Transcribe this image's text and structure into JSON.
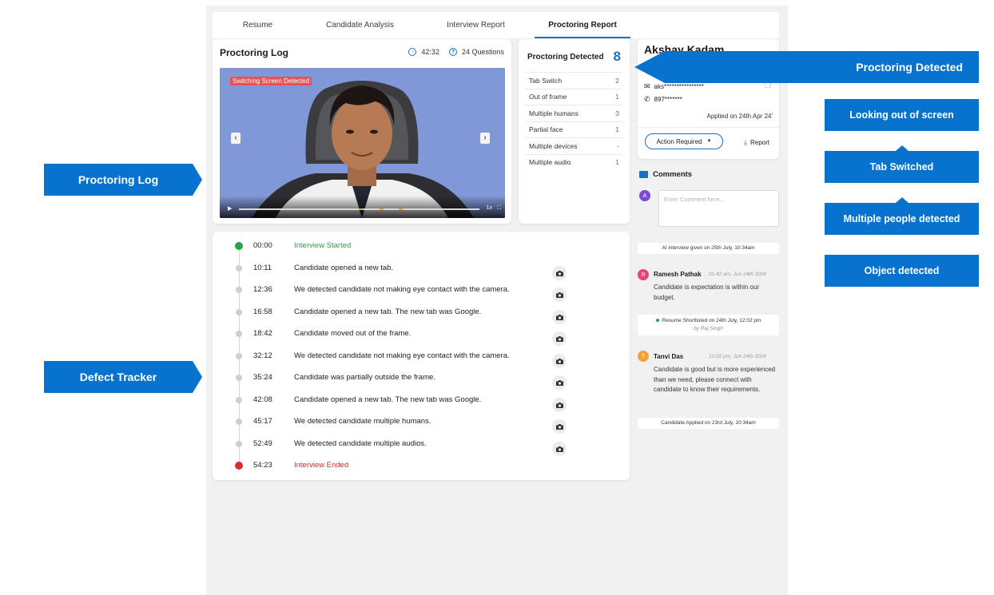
{
  "tabs": [
    {
      "label": "Resume",
      "active": false
    },
    {
      "label": "Candidate Analysis",
      "active": false
    },
    {
      "label": "Interview Report",
      "active": false
    },
    {
      "label": "Proctoring Report",
      "active": true
    }
  ],
  "proctoring_log": {
    "title": "Proctoring Log",
    "duration": "42:32",
    "questions": "24 Questions",
    "video": {
      "banner": "Switching Screen Detected",
      "speed": "1x",
      "prev_icon": "chevron-left-icon",
      "next_icon": "chevron-right-icon"
    }
  },
  "proctoring_detected": {
    "title": "Proctoring Detected",
    "count": "8",
    "items": [
      {
        "label": "Tab Switch",
        "value": "2"
      },
      {
        "label": "Out of frame",
        "value": "1"
      },
      {
        "label": "Multiple humans",
        "value": "3"
      },
      {
        "label": "Partial face",
        "value": "1"
      },
      {
        "label": "Multiple devices",
        "value": "-"
      },
      {
        "label": "Multiple audio",
        "value": "1"
      }
    ]
  },
  "defect_tracker": {
    "events": [
      {
        "time": "00:00",
        "text": "Interview Started",
        "kind": "start"
      },
      {
        "time": "10:11",
        "text": "Candidate opened a new tab.",
        "kind": "event"
      },
      {
        "time": "12:36",
        "text": "We detected candidate not making eye contact with the camera.",
        "kind": "event"
      },
      {
        "time": "16:58",
        "text": "Candidate opened a new tab. The new tab was Google.",
        "kind": "event"
      },
      {
        "time": "18:42",
        "text": "Candidate moved out of the frame.",
        "kind": "event"
      },
      {
        "time": "32:12",
        "text": "We detected candidate not making eye contact with the camera.",
        "kind": "event"
      },
      {
        "time": "35:24",
        "text": "Candidate was partially outside the frame.",
        "kind": "event"
      },
      {
        "time": "42:08",
        "text": "Candidate opened a new tab. The new tab was Google.",
        "kind": "event"
      },
      {
        "time": "45:17",
        "text": "We detected candidate multiple humans.",
        "kind": "event"
      },
      {
        "time": "52:49",
        "text": "We detected candidate multiple audios.",
        "kind": "event"
      },
      {
        "time": "54:23",
        "text": "Interview Ended",
        "kind": "end"
      }
    ]
  },
  "candidate": {
    "name": "Akshay Kadam",
    "email": "aks****************",
    "phone": "897*******",
    "applied": "Applied on 24th Apr 24'",
    "action_label": "Action Required",
    "report_label": "Report"
  },
  "comments": {
    "title": "Comments",
    "user_initial": "A",
    "placeholder": "Enter Comment here...",
    "activity_1": "AI interview given on 25th July, 10:34am",
    "comment_1": {
      "initial": "R",
      "name": "Ramesh Pathak",
      "time": "01:42 am, Jun 24th 2024",
      "text": "Candidate is expectation is within our budget."
    },
    "activity_2": "Resume Shortlisted on 24th July, 12:02 pm",
    "activity_2_by": "by Raj Singh",
    "comment_2": {
      "initial": "T",
      "name": "Tanvi Das",
      "time": "12:02 pm, Jun 24th 2024",
      "text": "Candidate is good but is more experienced than we need, please connect with candidate to know their requirements."
    },
    "activity_3": "Candidate Applied on 23rd July, 10:34am"
  },
  "callouts": {
    "proctoring_log": "Proctoring Log",
    "defect_tracker": "Defect Tracker",
    "proctoring_detected": "Proctoring Detected",
    "looking_out": "Looking out of screen",
    "tab_switched": "Tab Switched",
    "multiple_people": "Multiple people detected",
    "object_detected": "Object detected"
  },
  "colors": {
    "accent": "#0873cf",
    "brand": "#1f6fc1",
    "start": "#2aa247",
    "end": "#d92d2d"
  }
}
